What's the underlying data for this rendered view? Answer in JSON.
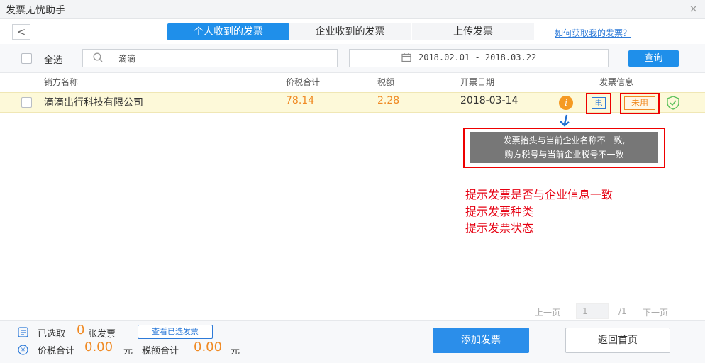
{
  "window": {
    "title": "发票无忧助手",
    "close_glyph": "×"
  },
  "nav": {
    "back_glyph": "<"
  },
  "tabs": [
    {
      "label": "个人收到的发票",
      "active": true
    },
    {
      "label": "企业收到的发票",
      "active": false
    },
    {
      "label": "上传发票",
      "active": false
    }
  ],
  "help_link": "如何获取我的发票？",
  "filter": {
    "select_all_label": "全选",
    "search_value": "滴滴",
    "date_range": "2018.02.01 - 2018.03.22",
    "query_label": "查询"
  },
  "columns": [
    "销方名称",
    "价税合计",
    "税额",
    "开票日期",
    "发票信息"
  ],
  "rows": [
    {
      "seller": "滴滴出行科技有限公司",
      "total": "78.14",
      "tax": "2.28",
      "date": "2018-03-14",
      "info_glyph": "i",
      "type_badge": "电",
      "status_badge": "未用"
    }
  ],
  "tooltip": {
    "line1": "发票抬头与当前企业名称不一致,",
    "line2": "购方税号与当前企业税号不一致"
  },
  "notes": [
    "提示发票是否与企业信息一致",
    "提示发票种类",
    "提示发票状态"
  ],
  "pagination": {
    "prev": "上一页",
    "current": "1",
    "total": "/1",
    "next": "下一页"
  },
  "footer": {
    "selected_prefix": "已选取",
    "selected_count": "0",
    "selected_suffix": "张发票",
    "view_selected_label": "查看已选发票",
    "total_label": "价税合计",
    "total_value": "0.00",
    "yuan1": "元",
    "tax_label": "税额合计",
    "tax_value": "0.00",
    "yuan2": "元",
    "add_label": "添加发票",
    "home_label": "返回首页"
  },
  "colors": {
    "accent": "#1f8fea",
    "amount": "#f08a24",
    "highlight_row": "#fdf9d9",
    "annotation_red": "#e60012"
  },
  "icons": [
    "close-icon",
    "back-icon",
    "search-icon",
    "calendar-icon",
    "info-icon",
    "shield-check-icon",
    "arrow-down-icon",
    "list-icon",
    "yuan-icon"
  ]
}
